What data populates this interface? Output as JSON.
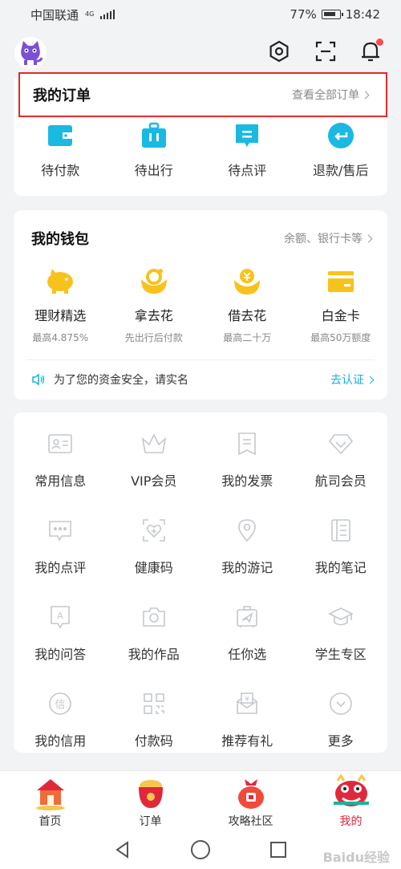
{
  "status": {
    "carrier": "中国联通",
    "network": "4G",
    "battery": "77%",
    "time": "18:42"
  },
  "orders": {
    "title": "我的订单",
    "link": "查看全部订单",
    "items": [
      {
        "label": "待付款",
        "icon": "wallet-icon"
      },
      {
        "label": "待出行",
        "icon": "luggage-icon"
      },
      {
        "label": "待点评",
        "icon": "comment-icon"
      },
      {
        "label": "退款/售后",
        "icon": "refund-icon"
      }
    ]
  },
  "wallet": {
    "title": "我的钱包",
    "link": "余额、银行卡等",
    "items": [
      {
        "label": "理财精选",
        "sub": "最高4.875%",
        "icon": "piggy-bank-icon"
      },
      {
        "label": "拿去花",
        "sub": "先出行后付款",
        "icon": "flower-pay-icon"
      },
      {
        "label": "借去花",
        "sub": "最高二十万",
        "icon": "loan-icon"
      },
      {
        "label": "白金卡",
        "sub": "最高50万额度",
        "icon": "card-icon"
      }
    ],
    "notice": "为了您的资金安全，请实名",
    "notice_action": "去认证"
  },
  "services": [
    {
      "label": "常用信息",
      "icon": "id-card-icon"
    },
    {
      "label": "VIP会员",
      "icon": "crown-icon"
    },
    {
      "label": "我的发票",
      "icon": "invoice-icon"
    },
    {
      "label": "航司会员",
      "icon": "diamond-icon"
    },
    {
      "label": "我的点评",
      "icon": "comment-dots-icon"
    },
    {
      "label": "健康码",
      "icon": "health-code-icon"
    },
    {
      "label": "我的游记",
      "icon": "location-pin-icon"
    },
    {
      "label": "我的笔记",
      "icon": "notebook-icon"
    },
    {
      "label": "我的问答",
      "icon": "qa-icon"
    },
    {
      "label": "我的作品",
      "icon": "camera-icon"
    },
    {
      "label": "任你选",
      "icon": "suitcase-plane-icon"
    },
    {
      "label": "学生专区",
      "icon": "graduation-cap-icon"
    },
    {
      "label": "我的信用",
      "icon": "credit-icon"
    },
    {
      "label": "付款码",
      "icon": "qr-code-icon"
    },
    {
      "label": "推荐有礼",
      "icon": "yuan-envelope-icon"
    },
    {
      "label": "更多",
      "icon": "more-chevron-icon"
    }
  ],
  "tabs": [
    {
      "label": "首页",
      "icon": "home-tab-icon"
    },
    {
      "label": "订单",
      "icon": "order-tab-icon"
    },
    {
      "label": "攻略社区",
      "icon": "community-tab-icon"
    },
    {
      "label": "我的",
      "icon": "mine-tab-icon"
    }
  ],
  "watermark": "Baidu经验",
  "colors": {
    "accent": "#19b9e2",
    "gold": "#f8c21c",
    "highlight_border": "#e32a2a",
    "active_tab": "#e0283c"
  }
}
